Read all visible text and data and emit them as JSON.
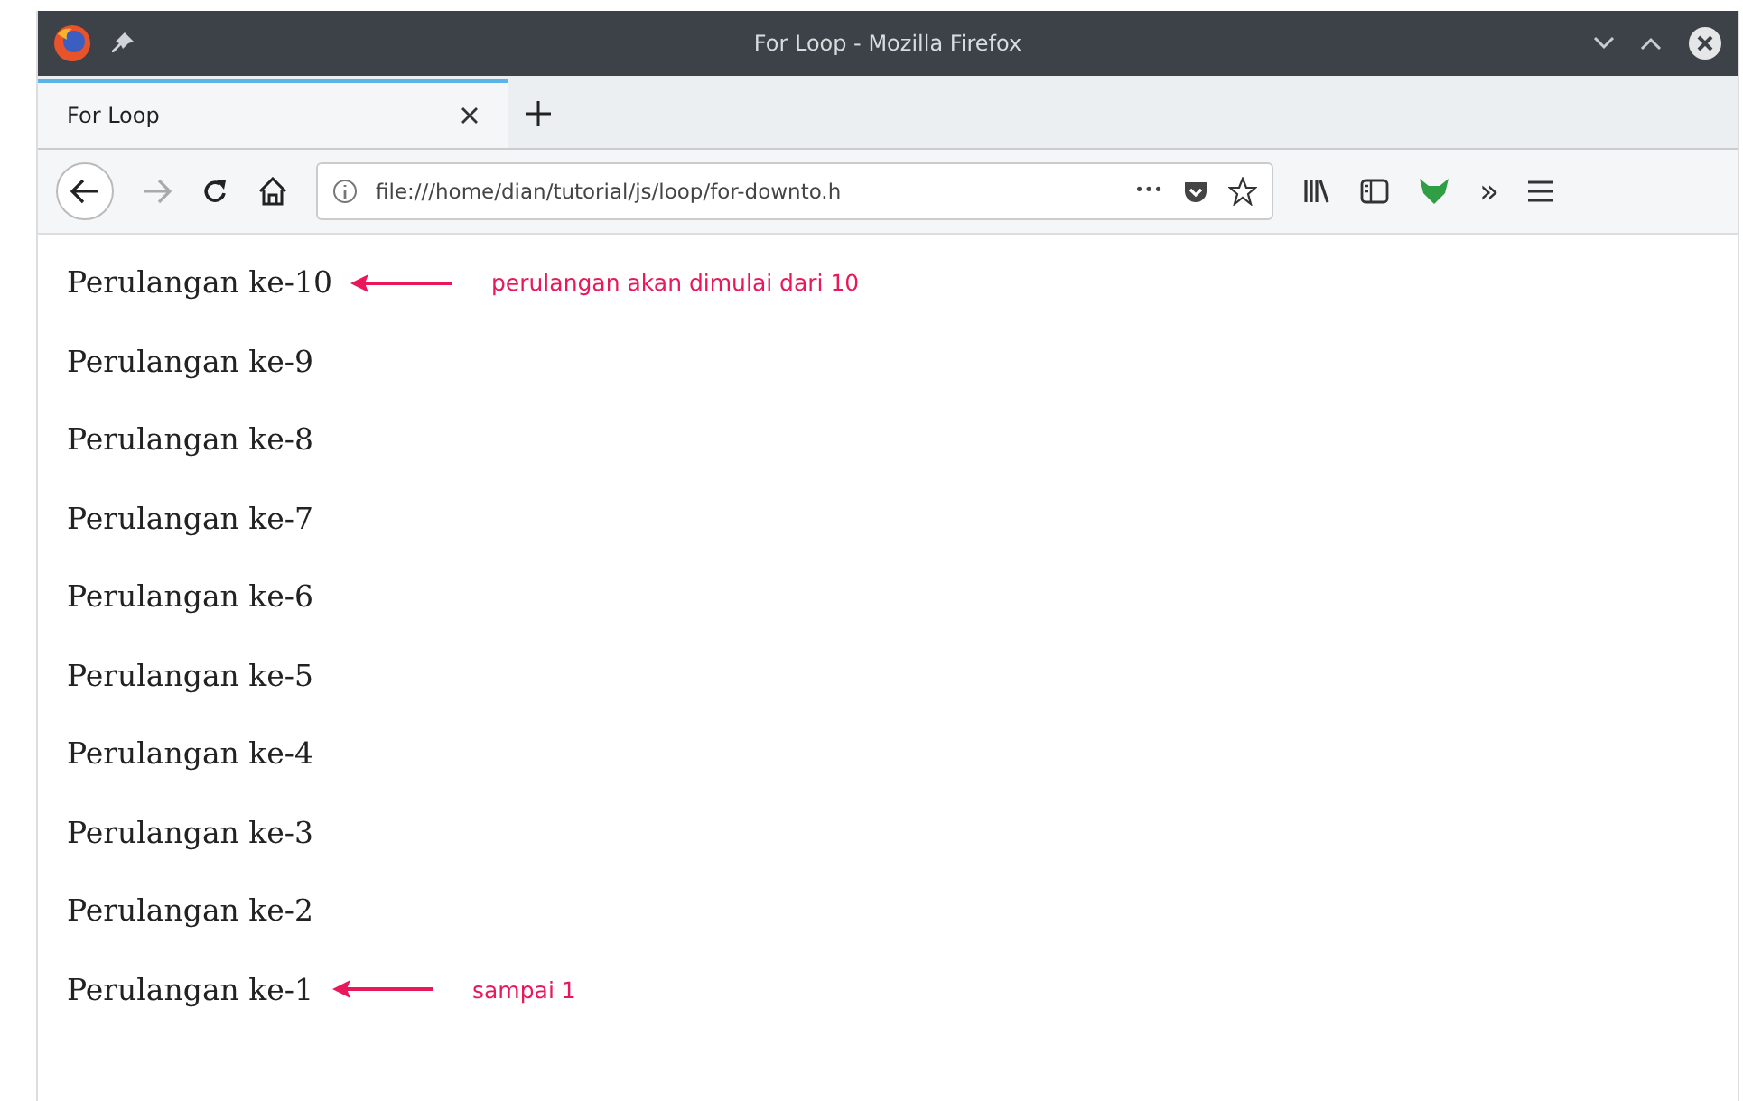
{
  "window": {
    "title": "For Loop - Mozilla Firefox"
  },
  "tabs": [
    {
      "label": "For Loop",
      "selected": true
    }
  ],
  "address_bar": {
    "value": "file:///home/dian/tutorial/js/loop/for-downto.h"
  },
  "toolbar_overflow": "»",
  "page_actions": "•••",
  "lines": [
    {
      "text": "Perulangan ke-10",
      "annotation": "perulangan akan dimulai dari 10"
    },
    {
      "text": "Perulangan ke-9"
    },
    {
      "text": "Perulangan ke-8"
    },
    {
      "text": "Perulangan ke-7"
    },
    {
      "text": "Perulangan ke-6"
    },
    {
      "text": "Perulangan ke-5"
    },
    {
      "text": "Perulangan ke-4"
    },
    {
      "text": "Perulangan ke-3"
    },
    {
      "text": "Perulangan ke-2"
    },
    {
      "text": "Perulangan ke-1",
      "annotation": "sampai 1"
    }
  ]
}
